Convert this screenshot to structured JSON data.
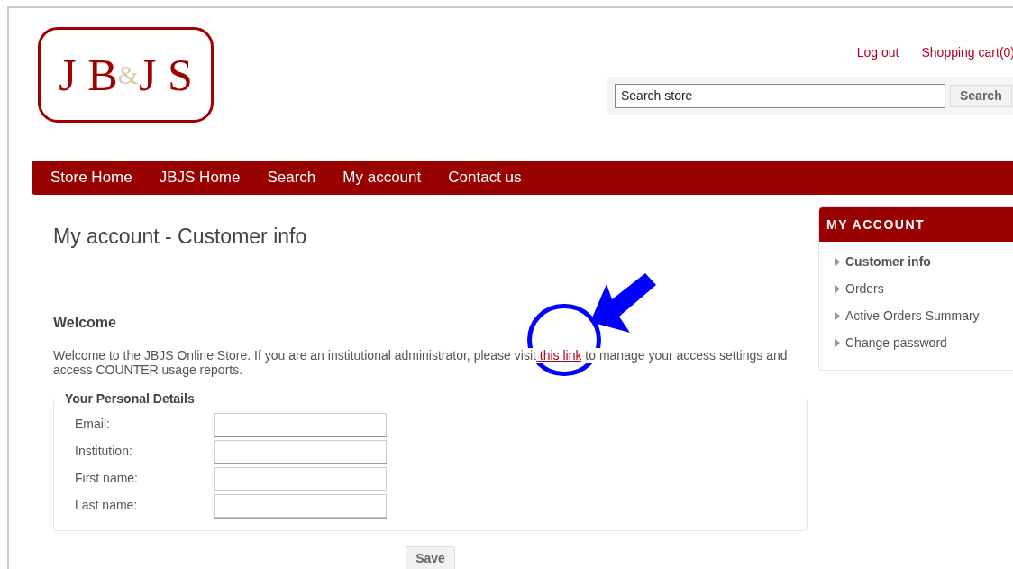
{
  "logo": {
    "parts": [
      "J B",
      "&",
      "J S"
    ]
  },
  "header_links": [
    "Log out",
    "Shopping cart(0)"
  ],
  "search": {
    "value": "Search store",
    "button": "Search"
  },
  "nav": [
    "Store Home",
    "JBJS Home",
    "Search",
    "My account",
    "Contact us"
  ],
  "page_title": "My account - Customer info",
  "welcome": {
    "heading": "Welcome",
    "before": "Welcome to the JBJS Online Store. If you are an institutional administrator, please visit",
    "link": " this link",
    "after": " to manage your access settings and access COUNTER usage reports."
  },
  "personal_details": {
    "legend": "Your Personal Details",
    "fields": [
      {
        "label": "Email:"
      },
      {
        "label": "Institution:"
      },
      {
        "label": "First name:"
      },
      {
        "label": "Last name:"
      }
    ],
    "button": "Save"
  },
  "sidebar": {
    "title": "MY ACCOUNT",
    "items": [
      {
        "label": "Customer info",
        "selected": true
      },
      {
        "label": "Orders",
        "selected": false
      },
      {
        "label": "Active Orders Summary",
        "selected": false
      },
      {
        "label": "Change password",
        "selected": false
      }
    ]
  }
}
